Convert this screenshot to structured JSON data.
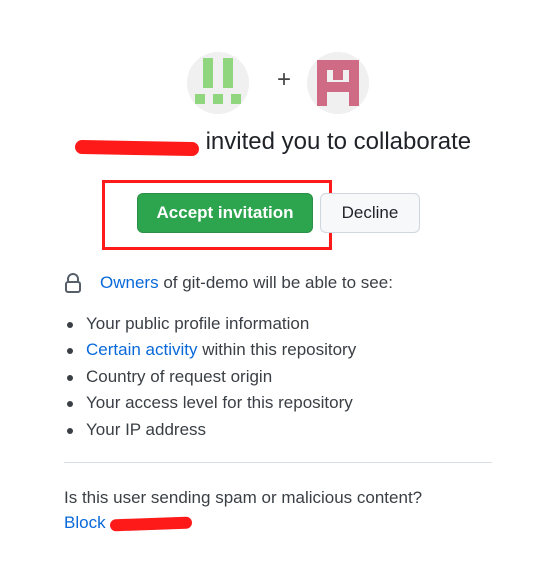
{
  "invite": {
    "plus": "+",
    "inviter_name": "",
    "headline_suffix": "invited you to collaborate"
  },
  "actions": {
    "accept_label": "Accept invitation",
    "decline_label": "Decline"
  },
  "permissions": {
    "owners_link": "Owners",
    "intro_rest": "of git-demo will be able to see:",
    "items": [
      {
        "text": "Your public profile information"
      },
      {
        "link": "Certain activity",
        "text": "within this repository"
      },
      {
        "text": "Country of request origin"
      },
      {
        "text": "Your access level for this repository"
      },
      {
        "text": "Your IP address"
      }
    ]
  },
  "spam": {
    "question": "Is this user sending spam or malicious content?",
    "block_label": "Block"
  },
  "colors": {
    "accept_green": "#2da44e",
    "link_blue": "#0969da",
    "annotation_red": "#ff1a1a",
    "avatar_left_green": "#8fd67e",
    "avatar_right_pink": "#cf6b85"
  },
  "icons": {
    "lock": "lock-icon",
    "plus": "plus-icon"
  }
}
